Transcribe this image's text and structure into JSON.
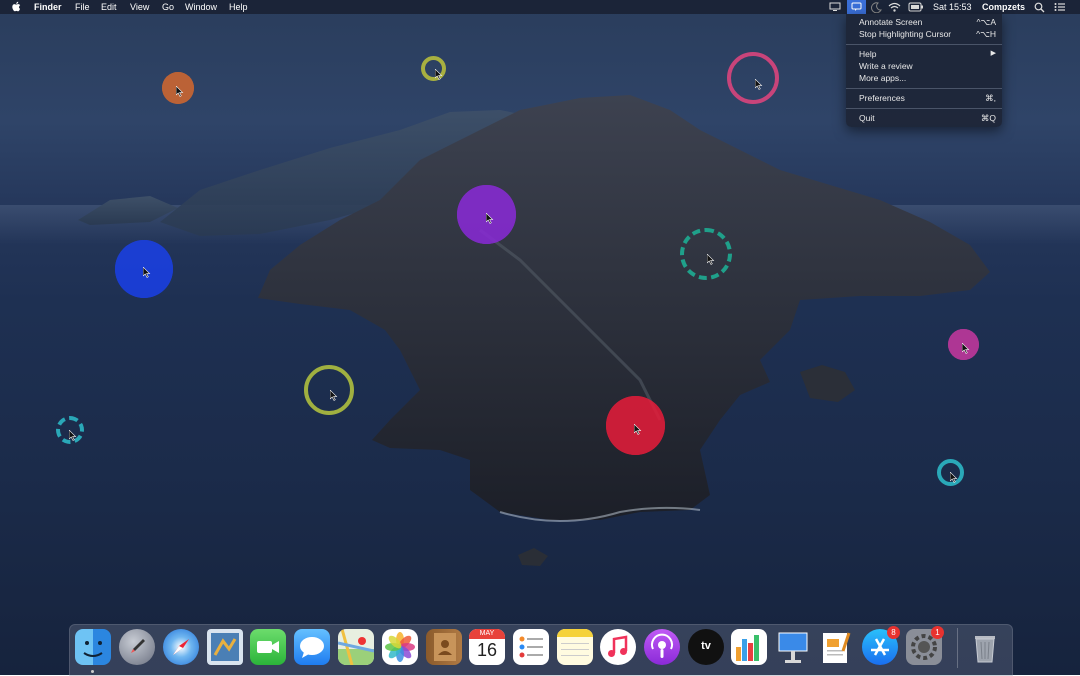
{
  "menubar": {
    "apple_icon": "apple-icon",
    "app_name": "Finder",
    "menus": [
      "File",
      "Edit",
      "View",
      "Go",
      "Window",
      "Help"
    ],
    "clock": "Sat 15:53",
    "user": "Compzets",
    "status_icons": [
      "display-icon",
      "annotate-icon",
      "moon-icon",
      "wifi-icon",
      "battery-icon",
      "search-icon",
      "list-icon"
    ]
  },
  "dropdown": {
    "items": [
      {
        "label": "Annotate Screen",
        "shortcut": "^⌥A"
      },
      {
        "label": "Stop Highlighting Cursor",
        "shortcut": "^⌥H"
      },
      {
        "label": "Help",
        "shortcut": "▶"
      },
      {
        "label": "Write a review",
        "shortcut": ""
      },
      {
        "label": "More apps...",
        "shortcut": ""
      },
      {
        "label": "Preferences",
        "shortcut": "⌘,"
      },
      {
        "label": "Quit",
        "shortcut": "⌘Q"
      }
    ]
  },
  "highlights": [
    {
      "color": "#d4682e",
      "style": "filled"
    },
    {
      "color": "#a8b040",
      "style": "ring"
    },
    {
      "color": "#c8447a",
      "style": "ring"
    },
    {
      "color": "#8a2ad8",
      "style": "filled"
    },
    {
      "color": "#1a40e8",
      "style": "filled"
    },
    {
      "color": "#1fa08a",
      "style": "dashed"
    },
    {
      "color": "#a0b040",
      "style": "ring"
    },
    {
      "color": "#e81c3a",
      "style": "filled"
    },
    {
      "color": "#c838a0",
      "style": "filled"
    },
    {
      "color": "#2aa8b8",
      "style": "dashed"
    },
    {
      "color": "#2aa8b8",
      "style": "ring"
    }
  ],
  "dock": {
    "apps": [
      "Finder",
      "Launchpad",
      "Safari",
      "Mail",
      "FaceTime",
      "Messages",
      "Maps",
      "Photos",
      "Contacts",
      "Calendar",
      "Reminders",
      "Notes",
      "Music",
      "Podcasts",
      "TV",
      "Numbers",
      "Keynote",
      "Pages",
      "App Store",
      "System Preferences",
      "Trash"
    ],
    "calendar_month": "MAY",
    "calendar_day": "16",
    "tv_label": "tv",
    "app_store_badge": "8",
    "system_prefs_badge": "1"
  }
}
